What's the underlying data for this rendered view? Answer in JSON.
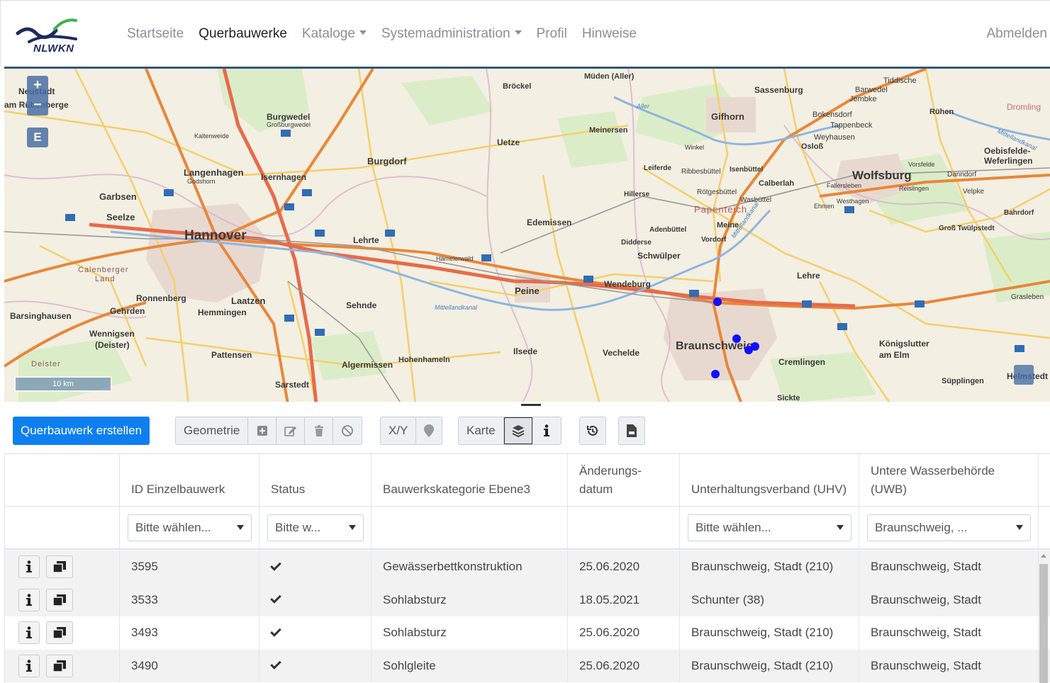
{
  "brand": {
    "name": "NLWKN"
  },
  "nav": {
    "items": [
      {
        "label": "Startseite",
        "active": false,
        "dropdown": false
      },
      {
        "label": "Querbauwerke",
        "active": true,
        "dropdown": false
      },
      {
        "label": "Kataloge",
        "active": false,
        "dropdown": true
      },
      {
        "label": "Systemadministration",
        "active": false,
        "dropdown": true
      },
      {
        "label": "Profil",
        "active": false,
        "dropdown": false
      },
      {
        "label": "Hinweise",
        "active": false,
        "dropdown": false
      }
    ],
    "logout": "Abmelden"
  },
  "map": {
    "zoom_in": "+",
    "zoom_out": "−",
    "editor_button": "E",
    "scale_label": "10 km",
    "places": [
      "Neustadt am Rübenberge",
      "Bröckel",
      "Müden (Aller)",
      "Sassenburg",
      "Tiddische",
      "Barwedel",
      "Jembke",
      "Rühen",
      "Gifhorn",
      "Bokensdorf",
      "Tappenbeck",
      "Weyhausen",
      "Osloß",
      "Dromling",
      "Burgwedel",
      "Großburgwedel",
      "Meinersen",
      "Uetze",
      "Winkel",
      "Oebisfelde-Weferlingen",
      "Kaltenweide",
      "Langenhagen",
      "Godshorn",
      "Isernhagen",
      "Burgdorf",
      "Leiferde",
      "Ribbesbüttel",
      "Isenbüttel",
      "Calberlah",
      "Wolfsburg",
      "Danndorf",
      "Vorsfelde",
      "Fallersleben",
      "Velpke",
      "Garbsen",
      "Seelze",
      "Hillerse",
      "Rötgesbüttel",
      "Wasbüttel",
      "Reislingen",
      "Westhagen",
      "Ehmen",
      "Papenteich",
      "Bahrdorf",
      "Hannover",
      "Lehrte",
      "Edemissen",
      "Adenbüttel",
      "Meine",
      "Vordorf",
      "Groß Twülpstedt",
      "Calenberger Land",
      "Didderse",
      "Schwülper",
      "Ronnenberg",
      "Laatzen",
      "Hämelerwald",
      "Peine",
      "Wendeburg",
      "Lehre",
      "Barsinghausen",
      "Gehrden",
      "Hemmingen",
      "Sehnde",
      "Grasleben",
      "Wennigsen (Deister)",
      "Braunschweig",
      "Königslutter am Elm",
      "Pattensen",
      "Ilsede",
      "Vechelde",
      "Cremlingen",
      "Algermissen",
      "Hohenhameln",
      "Deister",
      "Sarstedt",
      "Süpplingen",
      "Sickte",
      "Helmstedt",
      "Mittellandkanal",
      "Aller"
    ],
    "markers_count": 5
  },
  "toolbar": {
    "create_button": "Querbauwerk erstellen",
    "geometry_label": "Geometrie",
    "xy_label": "X/Y",
    "karte_label": "Karte"
  },
  "table": {
    "columns": [
      "",
      "ID Einzelbauwerk",
      "Status",
      "Bauwerkskategorie Ebene3",
      "Änderungs-\ndatum",
      "Unterhaltungsverband (UHV)",
      "Untere Wasserbehörde (UWB)"
    ],
    "filters": {
      "id": "Bitte wählen...",
      "status": "Bitte w...",
      "uhv": "Bitte wählen...",
      "uwb": "Braunschweig, ..."
    },
    "rows": [
      {
        "id": "3595",
        "kategorie": "Gewässerbettkonstruktion",
        "datum": "25.06.2020",
        "uhv": "Braunschweig, Stadt (210)",
        "uwb": "Braunschweig, Stadt"
      },
      {
        "id": "3533",
        "kategorie": "Sohlabsturz",
        "datum": "18.05.2021",
        "uhv": "Schunter (38)",
        "uwb": "Braunschweig, Stadt"
      },
      {
        "id": "3493",
        "kategorie": "Sohlabsturz",
        "datum": "25.06.2020",
        "uhv": "Braunschweig, Stadt (210)",
        "uwb": "Braunschweig, Stadt"
      },
      {
        "id": "3490",
        "kategorie": "Sohlgleite",
        "datum": "25.06.2020",
        "uhv": "Braunschweig, Stadt (210)",
        "uwb": "Braunschweig, Stadt"
      }
    ]
  },
  "colors": {
    "primary": "#0d7ff0",
    "map_marker": "#1010ff",
    "map_border": "#35567e"
  }
}
